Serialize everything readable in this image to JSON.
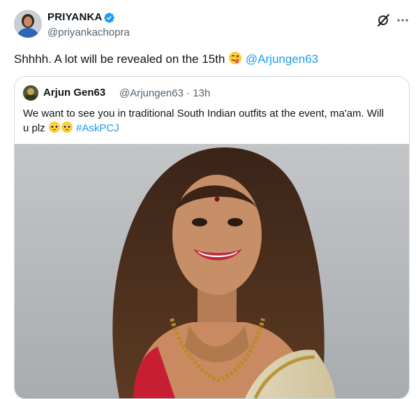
{
  "post": {
    "display_name": "PRIYANKA",
    "handle": "@priyankachopra",
    "text_before": "Shhhh. A lot will be revealed on the 15th ",
    "mention": "@Arjungen63"
  },
  "quoted": {
    "display_name": "Arjun Gen63",
    "handle": "@Arjungen63",
    "separator": "·",
    "time": "13h",
    "text_line1": "We want to see you in traditional South Indian outfits at the event, ma'am. Will",
    "text_line2": "u plz ",
    "hashtag": "#AskPCJ"
  },
  "icons": {
    "verified": "verified-badge-icon",
    "grok": "grok-icon",
    "more": "more-icon",
    "emoji_wink": "winking-face-tongue-icon",
    "emoji_plead": "pleading-face-icon"
  },
  "colors": {
    "accent": "#1d9bf0",
    "secondary_text": "#536471",
    "border": "#cfd9de"
  }
}
